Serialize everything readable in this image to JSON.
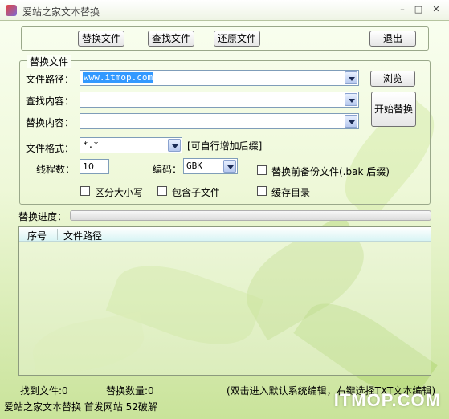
{
  "window": {
    "title": "爱站之家文本替换"
  },
  "toolbar": {
    "replace_files": "替换文件",
    "find_files": "查找文件",
    "restore_files": "还原文件",
    "exit": "退出"
  },
  "group": {
    "title": "替换文件",
    "path_label": "文件路径：",
    "path_value": "www.itmop.com",
    "find_label": "查找内容：",
    "find_value": "",
    "replace_label": "替换内容：",
    "replace_value": "",
    "browse_button": "浏览",
    "start_button": "开始替换"
  },
  "options": {
    "format_label": "文件格式：",
    "format_value": "*.*",
    "format_hint": "[可自行增加后缀]",
    "threads_label": "线程数：",
    "threads_value": "10",
    "encoding_label": "编码：",
    "encoding_value": "GBK",
    "backup_label": "替换前备份文件(.bak 后缀)",
    "backup_checked": false,
    "case_label": "区分大小写",
    "case_checked": false,
    "subfolders_label": "包含子文件",
    "subfolders_checked": false,
    "cache_dir_label": "缓存目录",
    "cache_dir_checked": false
  },
  "progress": {
    "label": "替换进度：",
    "value": 0
  },
  "table": {
    "columns": [
      "序号",
      "文件路径"
    ],
    "rows": []
  },
  "status": {
    "found_files": "找到文件:0",
    "replace_count": "替换数量:0",
    "hint": "(双击进入默认系统编辑，右键选择TXT文本编辑)",
    "footer": "爱站之家文本替换  首发网站 52破解"
  },
  "watermark": "ITMOP.COM",
  "colors": {
    "selection": "#3399ff",
    "background_top": "#fafff2",
    "background_bottom": "#c9e39a"
  }
}
